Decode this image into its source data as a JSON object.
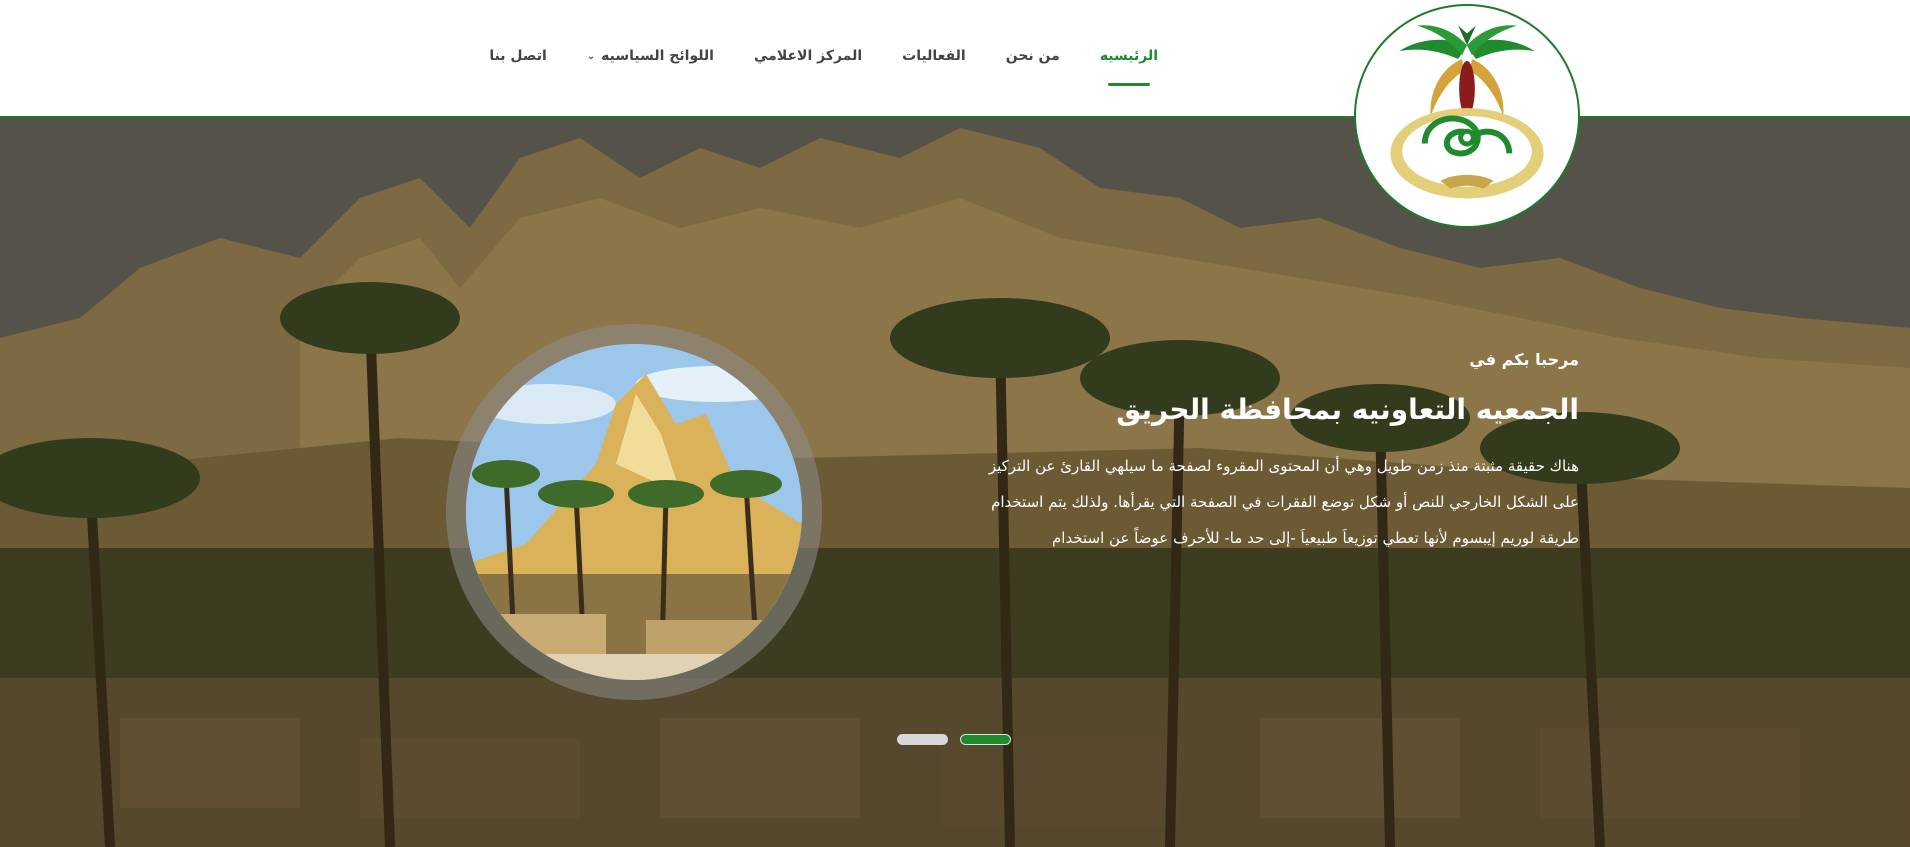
{
  "nav": {
    "items": [
      {
        "label": "الرئيسيه",
        "active": true
      },
      {
        "label": "من نحن"
      },
      {
        "label": "الفعاليات"
      },
      {
        "label": "المركز الاعلامي"
      },
      {
        "label": "اللوائح السياسيه",
        "has_dropdown": true
      },
      {
        "label": "اتصل بنا"
      }
    ]
  },
  "logo": {
    "icon": "palm-tree-handshake-emblem",
    "colors": {
      "green": "#1f8a2e",
      "gold": "#c9a64a",
      "red": "#8b1c1c"
    }
  },
  "hero": {
    "welcome_small": "مرحبا بكم في",
    "title": "الجمعيه التعاونيه بمحافظة الحريق",
    "body": "هناك حقيقة مثبتة منذ زمن طويل وهي أن المحتوى المقروء لصفحة ما سيلهي القارئ عن التركيز على الشكل الخارجي للنص أو شكل توضع الفقرات في الصفحة التي يقرأها. ولذلك يتم استخدام طريقة لوريم إيبسوم لأنها تعطي توزيعاَ طبيعياَ -إلى حد ما- للأحرف عوضاً عن استخدام",
    "slides": {
      "count": 2,
      "active": 1
    }
  },
  "colors": {
    "accent": "#1f8a2e",
    "nav_text": "#444444",
    "white": "#ffffff"
  }
}
